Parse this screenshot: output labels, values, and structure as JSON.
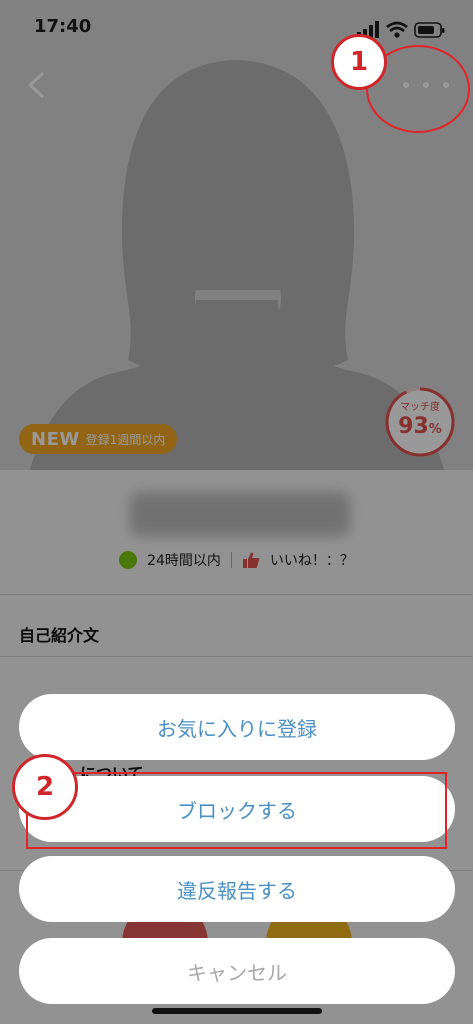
{
  "status_bar": {
    "time": "17:40"
  },
  "profile": {
    "new_badge": "NEW",
    "new_badge_sub": "登録1週間以内",
    "match_label": "マッチ度",
    "match_value": "93",
    "match_unit": "%",
    "match_percent": 93,
    "login_status": "24時間以内",
    "likes_label": "いいね！：？",
    "online_color": "#7cc70f"
  },
  "sections": {
    "self_intro": "自己紹介文",
    "about_partial": "について"
  },
  "action_sheet": {
    "favorite": "お気に入りに登録",
    "block": "ブロックする",
    "report": "違反報告する",
    "cancel": "キャンセル"
  },
  "annotations": {
    "step1": "1",
    "step2": "2"
  },
  "colors": {
    "accent_blue": "#4a90c4",
    "annotation_red": "#e0242a",
    "badge_orange": "#f2a824",
    "match_red": "#e05050"
  }
}
